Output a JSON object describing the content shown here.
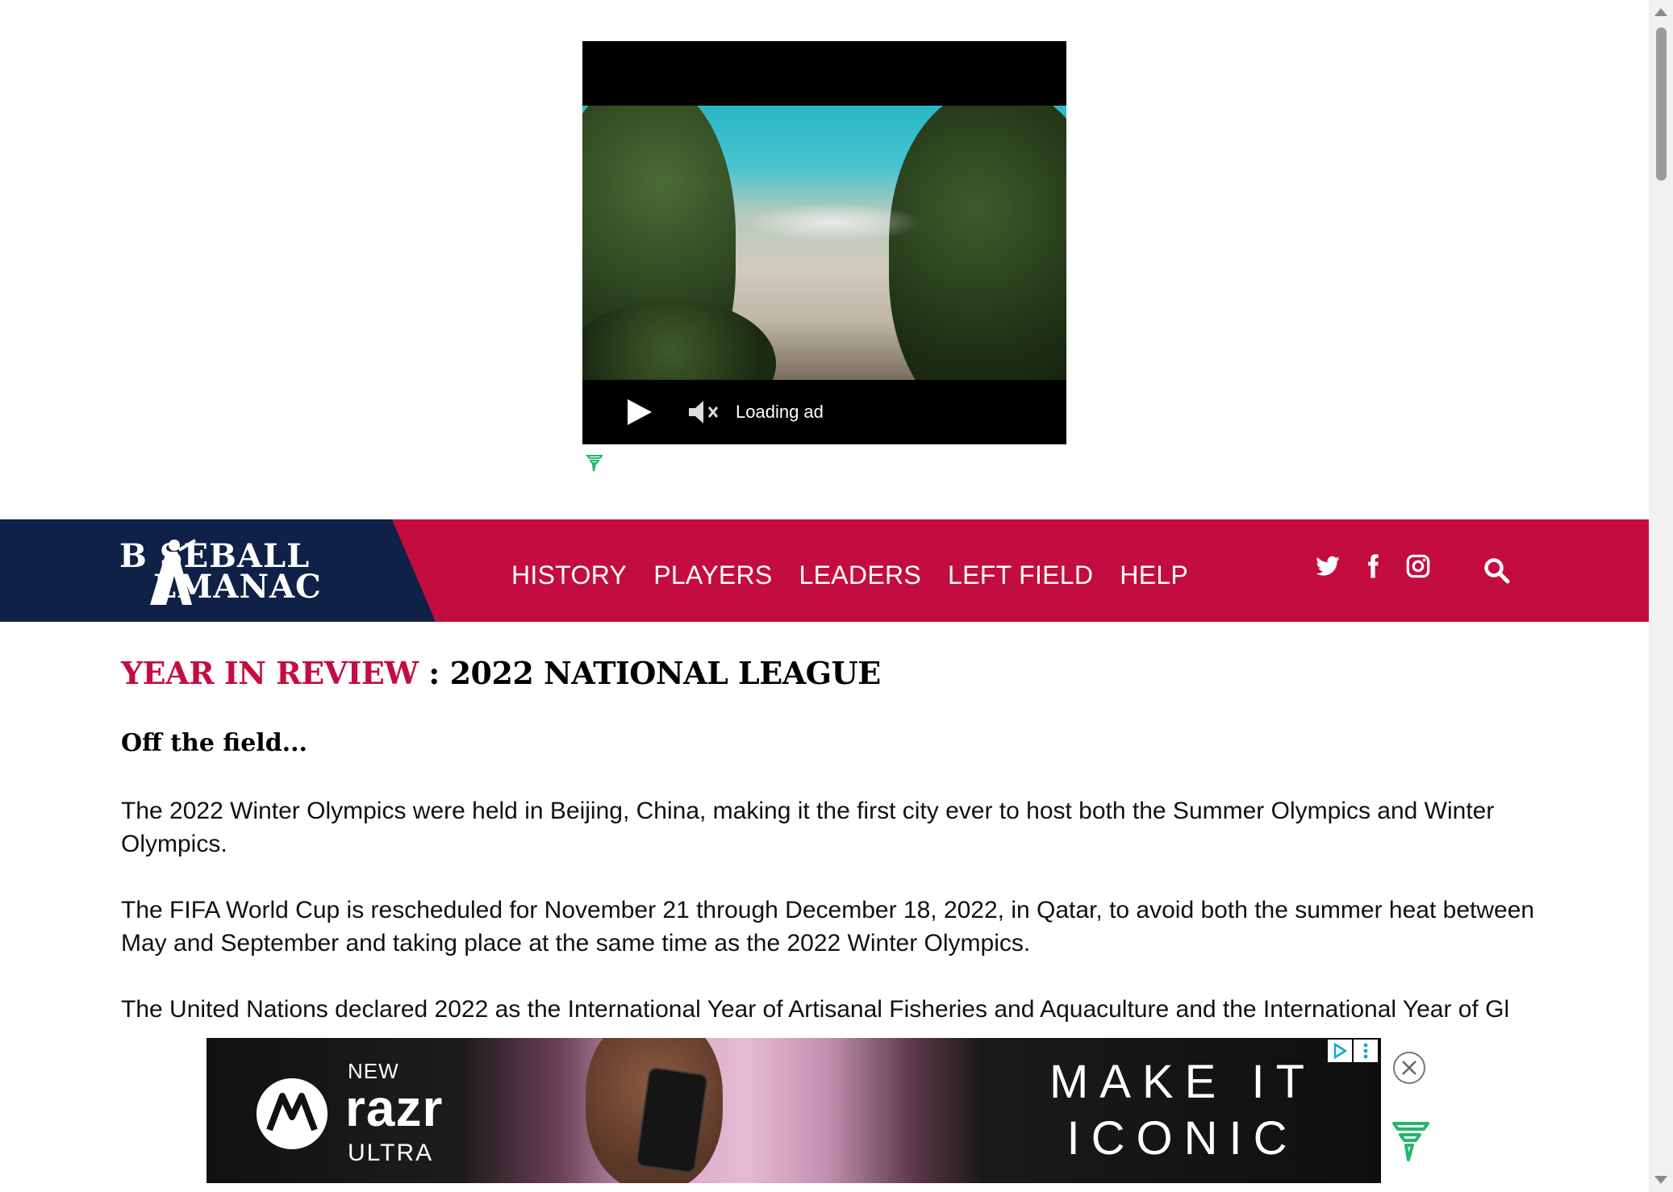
{
  "video_ad": {
    "status_text": "Loading ad",
    "icons": [
      "play-icon",
      "muted-speaker-icon",
      "freestar-icon"
    ]
  },
  "navbar": {
    "logo_line1": "B SEBALL",
    "logo_line2": "LMANAC",
    "items": [
      {
        "label": "HISTORY"
      },
      {
        "label": "PLAYERS"
      },
      {
        "label": "LEADERS"
      },
      {
        "label": "LEFT FIELD"
      },
      {
        "label": "HELP"
      }
    ],
    "social_icons": [
      "twitter-icon",
      "facebook-icon",
      "instagram-icon"
    ],
    "search_icon": "search-icon",
    "colors": {
      "bar": "#c30d3e",
      "logo_bg": "#0f2147"
    }
  },
  "article": {
    "title_accent": "YEAR IN REVIEW",
    "title_rest": " : 2022 NATIONAL LEAGUE",
    "section_heading": "Off the field...",
    "paragraphs": [
      "The 2022 Winter Olympics were held in Beijing, China, making it the first city ever to host both the Summer Olympics and Winter Olympics.",
      "The FIFA World Cup is rescheduled for November 21 through December 18, 2022, in Qatar, to avoid both the summer heat between May and September and taking place at the same time as the 2022 Winter Olympics.",
      "The United Nations declared 2022 as the International Year of Artisanal Fisheries and Aquaculture and the International Year of Gl"
    ]
  },
  "bottom_ad": {
    "badge": "NEW",
    "brand": "razr",
    "model": "ULTRA",
    "slogan": "MAKE IT ICONIC",
    "icons": [
      "motorola-logo-icon",
      "adchoices-icon",
      "ad-menu-icon",
      "close-icon",
      "freestar-icon"
    ]
  }
}
